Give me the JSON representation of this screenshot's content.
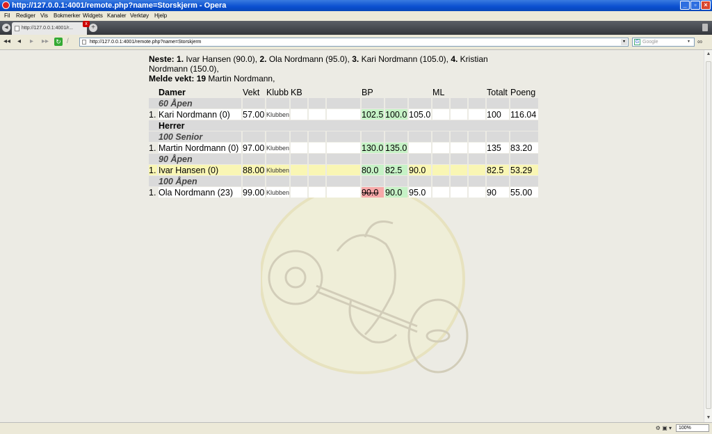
{
  "window": {
    "title": "http://127.0.0.1:4001/remote.php?name=Storskjerm - Opera"
  },
  "menu": [
    "Fil",
    "Rediger",
    "Vis",
    "Bokmerker",
    "Widgets",
    "Kanaler",
    "Verktøy",
    "Hjelp"
  ],
  "tab": {
    "label": "http://127.0.0.1:4001/r..."
  },
  "address": {
    "url": "http://127.0.0.1:4001/remote.php?name=Storskjerm"
  },
  "search": {
    "placeholder": "Google"
  },
  "status": {
    "zoom": "100%"
  },
  "info": {
    "next_label": "Neste:",
    "next": [
      {
        "num": "1.",
        "name": "Ivar Hansen (90.0),"
      },
      {
        "num": "2.",
        "name": "Ola Nordmann (95.0),"
      },
      {
        "num": "3.",
        "name": "Kari Nordmann (105.0),"
      },
      {
        "num": "4.",
        "name": "Kristian Nordmann (150.0),"
      }
    ],
    "weigh_label": "Melde vekt:",
    "weigh_num": "19",
    "weigh_name": "Martin Nordmann,"
  },
  "table": {
    "headers": {
      "name": "Damer",
      "weight": "Vekt",
      "club": "Klubb",
      "kb": "KB",
      "bp": "BP",
      "ml": "ML",
      "total": "Totalt",
      "points": "Poeng"
    },
    "sections": [
      {
        "category": "",
        "division": "60 Åpen",
        "rows": [
          {
            "rank": "1.",
            "name": "Kari Nordmann (0)",
            "weight": "57.00",
            "club": "Klubben",
            "bp1": "102.5",
            "bp1_state": "ok",
            "bp2": "100.0",
            "bp2_state": "ok",
            "bp3": "105.0",
            "bp3_state": "",
            "total": "100",
            "points": "116.04",
            "highlight": false
          }
        ]
      },
      {
        "category": "Herrer",
        "division": "100 Senior",
        "rows": [
          {
            "rank": "1.",
            "name": "Martin Nordmann (0)",
            "weight": "97.00",
            "club": "Klubben",
            "bp1": "130.0",
            "bp1_state": "ok",
            "bp2": "135.0",
            "bp2_state": "ok",
            "bp3": "",
            "bp3_state": "",
            "total": "135",
            "points": "83.20",
            "highlight": false
          }
        ]
      },
      {
        "category": "",
        "division": "90 Åpen",
        "rows": [
          {
            "rank": "1.",
            "name": "Ivar Hansen (0)",
            "weight": "88.00",
            "club": "Klubben",
            "bp1": "80.0",
            "bp1_state": "ok",
            "bp2": "82.5",
            "bp2_state": "ok",
            "bp3": "90.0",
            "bp3_state": "",
            "total": "82.5",
            "points": "53.29",
            "highlight": true
          }
        ]
      },
      {
        "category": "",
        "division": "100 Åpen",
        "rows": [
          {
            "rank": "1.",
            "name": "Ola Nordmann (23)",
            "weight": "99.00",
            "club": "Klubben",
            "bp1": "90.0",
            "bp1_state": "fail",
            "bp2": "90.0",
            "bp2_state": "ok",
            "bp3": "95.0",
            "bp3_state": "",
            "total": "90",
            "points": "55.00",
            "highlight": false
          }
        ]
      }
    ]
  }
}
